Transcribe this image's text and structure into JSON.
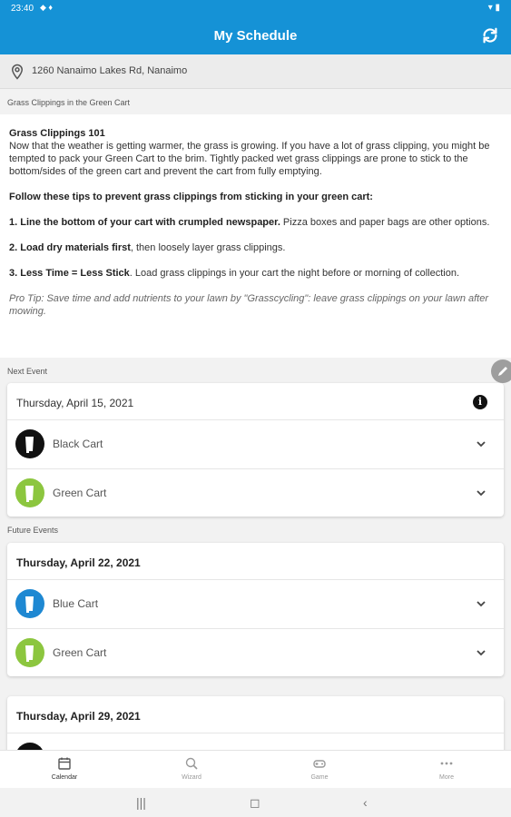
{
  "status": {
    "time": "23:40",
    "indicators": "◆ ♦",
    "right": "▾ ▮"
  },
  "header": {
    "title": "My Schedule",
    "refresh_icon": "refresh-icon"
  },
  "address": {
    "text": "1260 Nanaimo Lakes Rd, Nanaimo",
    "icon": "location-pin-icon"
  },
  "notice": {
    "section_label": "Grass Clippings in the Green Cart",
    "heading": "Grass Clippings 101",
    "intro": "Now that the weather is getting warmer, the grass is growing. If you have a lot of grass clipping, you might be tempted to pack your Green Cart to the brim. Tightly packed wet grass clippings are prone to stick to the bottom/sides of the green cart and prevent the cart from fully emptying.",
    "tips_heading": "Follow these tips to prevent grass clippings from sticking in your green cart:",
    "tip1_bold": "1. Line the bottom of your cart with crumpled newspaper.",
    "tip1_rest": " Pizza boxes and paper bags are other options.",
    "tip2_bold": "2. Load dry materials first",
    "tip2_rest": ", then loosely layer grass clippings.",
    "tip3_bold": "3. Less Time = Less Stick",
    "tip3_rest": ". Load grass clippings in your cart the night before or morning of collection.",
    "pro_tip": "Pro Tip: Save time and add nutrients to your lawn by \"Grasscycling\": leave grass clippings on your lawn after mowing."
  },
  "next_event": {
    "section_label": "Next Event",
    "date": "Thursday, April 15, 2021",
    "items": [
      {
        "label": "Black Cart",
        "color": "#111111"
      },
      {
        "label": "Green Cart",
        "color": "#8cc63f"
      }
    ]
  },
  "future_events": {
    "section_label": "Future Events",
    "events": [
      {
        "date": "Thursday, April 22, 2021",
        "items": [
          {
            "label": "Blue Cart",
            "color": "#1e88d2"
          },
          {
            "label": "Green Cart",
            "color": "#8cc63f"
          }
        ]
      },
      {
        "date": "Thursday, April 29, 2021",
        "items": [
          {
            "label": "",
            "color": "#111111"
          }
        ]
      }
    ]
  },
  "bottom_nav": [
    {
      "label": "Calendar",
      "icon": "calendar-icon",
      "active": true
    },
    {
      "label": "Wizard",
      "icon": "search-icon",
      "active": false
    },
    {
      "label": "Game",
      "icon": "gamepad-icon",
      "active": false
    },
    {
      "label": "More",
      "icon": "more-dots-icon",
      "active": false
    }
  ],
  "colors": {
    "accent": "#1592d6",
    "black_cart": "#111111",
    "green_cart": "#8cc63f",
    "blue_cart": "#1e88d2"
  }
}
